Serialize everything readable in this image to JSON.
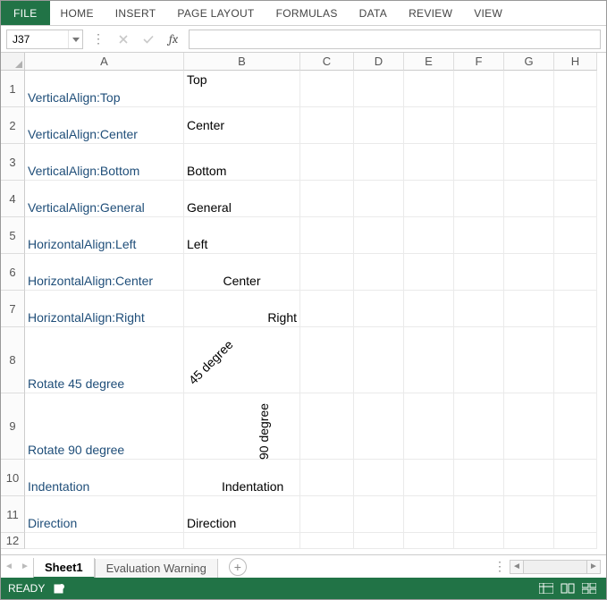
{
  "ribbon": {
    "tabs": [
      "FILE",
      "HOME",
      "INSERT",
      "PAGE LAYOUT",
      "FORMULAS",
      "DATA",
      "REVIEW",
      "VIEW"
    ]
  },
  "formula_bar": {
    "name_box": "J37",
    "formula": ""
  },
  "columns": [
    {
      "label": "A",
      "width": 178
    },
    {
      "label": "B",
      "width": 130
    },
    {
      "label": "C",
      "width": 60
    },
    {
      "label": "D",
      "width": 56
    },
    {
      "label": "E",
      "width": 56
    },
    {
      "label": "F",
      "width": 56
    },
    {
      "label": "G",
      "width": 56
    },
    {
      "label": "H",
      "width": 48
    }
  ],
  "rows": [
    {
      "label": "1",
      "height": 41,
      "a": "VerticalAlign:Top",
      "b": "Top",
      "b_halign": "left",
      "b_valign": "top",
      "a_valign": "bottom"
    },
    {
      "label": "2",
      "height": 41,
      "a": "VerticalAlign:Center",
      "b": "Center",
      "b_halign": "left",
      "b_valign": "center",
      "a_valign": "bottom"
    },
    {
      "label": "3",
      "height": 41,
      "a": "VerticalAlign:Bottom",
      "b": "Bottom",
      "b_halign": "left",
      "b_valign": "bottom",
      "a_valign": "bottom"
    },
    {
      "label": "4",
      "height": 41,
      "a": "VerticalAlign:General",
      "b": "General",
      "b_halign": "left",
      "b_valign": "bottom",
      "a_valign": "bottom"
    },
    {
      "label": "5",
      "height": 41,
      "a": "HorizontalAlign:Left",
      "b": "Left",
      "b_halign": "left",
      "b_valign": "bottom",
      "a_valign": "bottom"
    },
    {
      "label": "6",
      "height": 41,
      "a": "HorizontalAlign:Center",
      "b": "Center",
      "b_halign": "center",
      "b_valign": "bottom",
      "a_valign": "bottom"
    },
    {
      "label": "7",
      "height": 41,
      "a": "HorizontalAlign:Right",
      "b": "Right",
      "b_halign": "right",
      "b_valign": "bottom",
      "a_valign": "bottom"
    },
    {
      "label": "8",
      "height": 74,
      "a": "Rotate 45 degree",
      "b": "45 degree",
      "b_rotate": 45,
      "a_valign": "bottom"
    },
    {
      "label": "9",
      "height": 74,
      "a": "Rotate 90 degree",
      "b": "90 degree",
      "b_rotate": 90,
      "a_valign": "bottom"
    },
    {
      "label": "10",
      "height": 41,
      "a": "Indentation",
      "b": "Indentation",
      "b_halign": "left",
      "b_indent": 42,
      "b_valign": "bottom",
      "a_valign": "bottom"
    },
    {
      "label": "11",
      "height": 41,
      "a": "Direction",
      "b": "Direction",
      "b_halign": "left",
      "b_valign": "bottom",
      "a_valign": "bottom"
    },
    {
      "label": "12",
      "height": 18,
      "a": "",
      "b": ""
    }
  ],
  "sheets": {
    "tabs": [
      {
        "name": "Sheet1",
        "active": true
      },
      {
        "name": "Evaluation Warning",
        "active": false
      }
    ]
  },
  "status": {
    "text": "READY"
  }
}
